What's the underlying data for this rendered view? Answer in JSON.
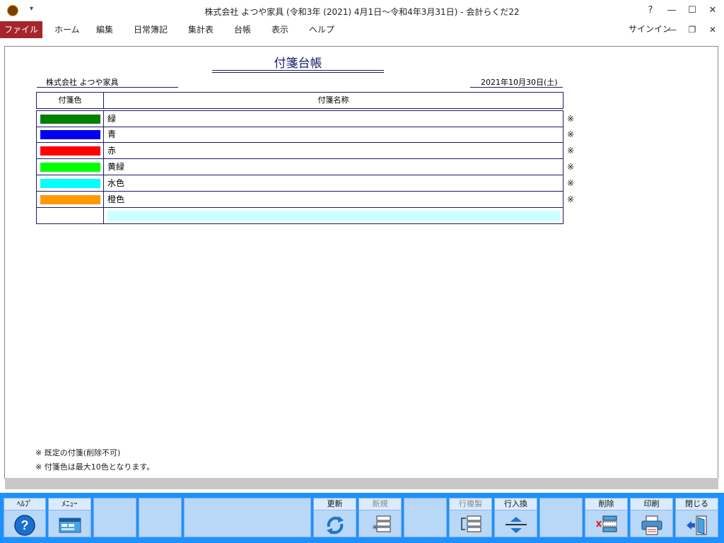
{
  "window": {
    "title": "株式会社 よつや家具 (令和3年 (2021) 4月1日～令和4年3月31日) - 会計らくだ22",
    "help_btn": "?",
    "minimize_btn": "—",
    "maximize_btn": "☐",
    "close_btn": "✕",
    "qat_dropdown": "▾"
  },
  "menu": {
    "file": "ファイル",
    "items": [
      "ホーム",
      "編集",
      "日常簿記",
      "集計表",
      "台帳",
      "表示",
      "ヘルプ"
    ],
    "signin": "サインイン",
    "mdi_minimize": "—",
    "mdi_restore": "❐",
    "mdi_close": "✕"
  },
  "report": {
    "title": "付箋台帳",
    "company": "株式会社 よつや家具",
    "date": "2021年10月30日(土)",
    "columns": [
      "付箋色",
      "付箋名称"
    ],
    "rows": [
      {
        "color": "#008000",
        "name": "緑",
        "mark": "※"
      },
      {
        "color": "#0000ee",
        "name": "青",
        "mark": "※"
      },
      {
        "color": "#ff0000",
        "name": "赤",
        "mark": "※"
      },
      {
        "color": "#00ff00",
        "name": "黄緑",
        "mark": "※"
      },
      {
        "color": "#00ffff",
        "name": "水色",
        "mark": "※"
      },
      {
        "color": "#ff9900",
        "name": "橙色",
        "mark": "※"
      }
    ],
    "new_row_value": "",
    "notes": [
      "※ 既定の付箋(削除不可)",
      "※ 付箋色は最大10色となります。"
    ]
  },
  "toolbar": {
    "keys": [
      {
        "label": "ﾍﾙﾌﾟ",
        "icon": "help-icon",
        "enabled": true
      },
      {
        "label": "ﾒﾆｭｰ",
        "icon": "menu-icon",
        "enabled": true
      },
      {
        "label": "",
        "icon": "",
        "enabled": false
      },
      {
        "label": "",
        "icon": "",
        "enabled": false
      },
      {
        "label": "",
        "icon": "",
        "enabled": false
      },
      {
        "label": "更新",
        "icon": "refresh-icon",
        "enabled": true
      },
      {
        "label": "新規",
        "icon": "new-row-icon",
        "enabled": false
      },
      {
        "label": "",
        "icon": "",
        "enabled": false
      },
      {
        "label": "行複製",
        "icon": "duplicate-row-icon",
        "enabled": false
      },
      {
        "label": "行入換",
        "icon": "swap-rows-icon",
        "enabled": true
      },
      {
        "label": "",
        "icon": "",
        "enabled": false
      },
      {
        "label": "削除",
        "icon": "delete-icon",
        "enabled": true
      },
      {
        "label": "印刷",
        "icon": "print-icon",
        "enabled": true
      },
      {
        "label": "閉じる",
        "icon": "close-door-icon",
        "enabled": true
      }
    ]
  }
}
